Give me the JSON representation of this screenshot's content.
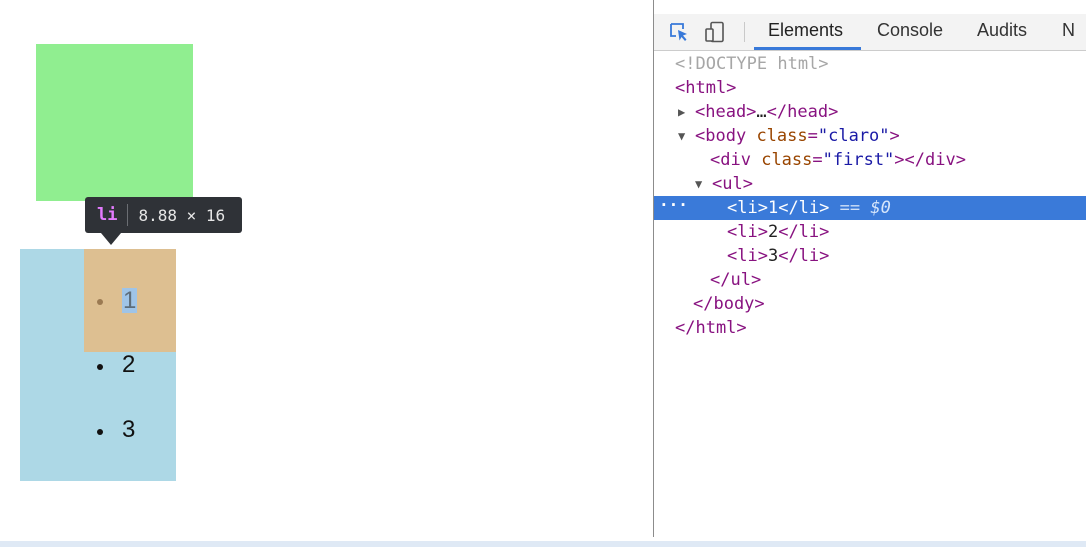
{
  "page": {
    "list_items": [
      "1",
      "2",
      "3"
    ],
    "tooltip": {
      "tag": "li",
      "dimensions": "8.88 × 16"
    }
  },
  "colors": {
    "green_div": "#90ee90",
    "ul_background": "#add8e6",
    "li_highlight": "#ddbf91",
    "tooltip_bg": "#2f3237",
    "selection": "#3a7ad9"
  },
  "devtools": {
    "tabs": [
      {
        "label": "Elements",
        "active": true
      },
      {
        "label": "Console",
        "active": false
      },
      {
        "label": "Audits",
        "active": false
      },
      {
        "label": "N",
        "active": false
      }
    ],
    "icons": [
      "inspect-element-icon",
      "device-toolbar-icon"
    ],
    "dom": {
      "doctype": "<!DOCTYPE html>",
      "html_open": "<html>",
      "head": {
        "open": "<head>",
        "ellipsis": "…",
        "close": "</head>"
      },
      "body": {
        "open_tag": "<body",
        "attr_name": "class",
        "eq": "=",
        "attr_value": "\"claro\"",
        "open_end": ">"
      },
      "div": {
        "open_tag": "<div",
        "attr_name": "class",
        "eq": "=",
        "attr_value": "\"first\"",
        "open_end": "></div>"
      },
      "ul_open": "<ul>",
      "li_items": [
        {
          "open": "<li>",
          "text": "1",
          "close": "</li>",
          "selected": true
        },
        {
          "open": "<li>",
          "text": "2",
          "close": "</li>",
          "selected": false
        },
        {
          "open": "<li>",
          "text": "3",
          "close": "</li>",
          "selected": false
        }
      ],
      "selected_suffix": {
        "eq": "==",
        "ref": "$0"
      },
      "ul_close": "</ul>",
      "body_close": "</body>",
      "html_close": "</html>",
      "row_ellipsis": "…"
    }
  }
}
